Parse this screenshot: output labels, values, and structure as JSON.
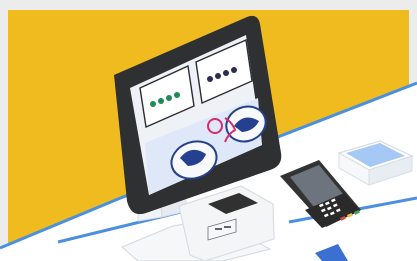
{
  "scene": {
    "kind": "self-service-kiosk-illustration",
    "colors": {
      "background_yellow": "#efbb1f",
      "outer_frame": "#ececec",
      "counter_top": "#ffffff",
      "counter_edge": "#4b8fe0",
      "kiosk_body": "#f2f3f5",
      "kiosk_shadow": "#dfe3ea",
      "screen_bezel": "#2f3031",
      "screen_panel": "#eef2f6",
      "screen_accent_blue": "#24408e",
      "screen_dots_green": "#1f8a55",
      "screen_dots_dark": "#2b2d4f",
      "screen_highlight_pink": "#d62d6c",
      "terminal_body": "#333333",
      "terminal_keypad": "#2a2a2a",
      "terminal_key_red": "#d74a4a",
      "terminal_key_yellow": "#e6c245",
      "terminal_key_green": "#41a35f",
      "scanner_blue": "#a5c8f5"
    },
    "icons": [
      "kiosk-icon",
      "touchscreen-icon",
      "payment-terminal-icon",
      "barcode-scanner-icon"
    ]
  }
}
